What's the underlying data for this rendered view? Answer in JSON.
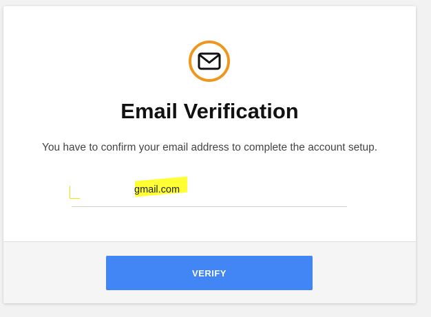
{
  "header": {
    "icon": "envelope-icon",
    "icon_color": "#f0961e",
    "title": "Email Verification",
    "subtitle": "You have to confirm your email address to complete the account setup."
  },
  "email_field": {
    "value": "gmail.com",
    "highlight_color": "#ffff33"
  },
  "footer": {
    "verify_label": "VERIFY",
    "button_color": "#4285f4"
  }
}
